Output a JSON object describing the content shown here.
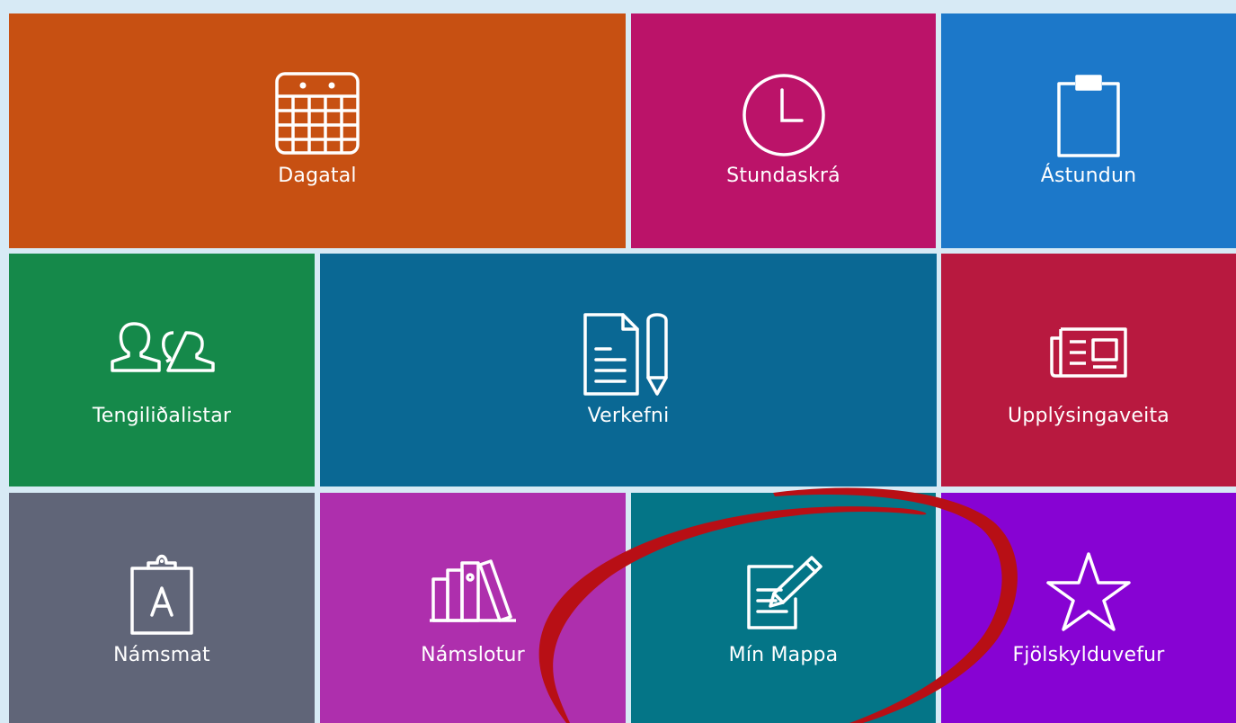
{
  "tiles": [
    {
      "key": "dagatal",
      "label": "Dagatal",
      "icon": "calendar-icon",
      "color": "#c75012"
    },
    {
      "key": "stundaskra",
      "label": "Stundaskrá",
      "icon": "clock-icon",
      "color": "#bb1369"
    },
    {
      "key": "astundun",
      "label": "Ástundun",
      "icon": "clipboard-icon",
      "color": "#1c78c9"
    },
    {
      "key": "tengilidalistar",
      "label": "Tengiliðalistar",
      "icon": "contacts-icon",
      "color": "#15894a"
    },
    {
      "key": "verkefni",
      "label": "Verkefni",
      "icon": "document-pencil-icon",
      "color": "#0a6894"
    },
    {
      "key": "upplysingaveita",
      "label": "Upplýsingaveita",
      "icon": "newspaper-icon",
      "color": "#b8193f"
    },
    {
      "key": "namsmat",
      "label": "Námsmat",
      "icon": "clipboard-grade-icon",
      "color": "#606578"
    },
    {
      "key": "namslotur",
      "label": "Námslotur",
      "icon": "books-icon",
      "color": "#ae2fad"
    },
    {
      "key": "min_mappa",
      "label": "Mín Mappa",
      "icon": "edit-document-icon",
      "color": "#047587"
    },
    {
      "key": "fjolskylduvefur",
      "label": "Fjölskylduvefur",
      "icon": "star-icon",
      "color": "#8703d3"
    }
  ],
  "annotation": {
    "type": "hand-drawn-ellipse",
    "color": "#b80f15",
    "target": "Mín Mappa"
  }
}
